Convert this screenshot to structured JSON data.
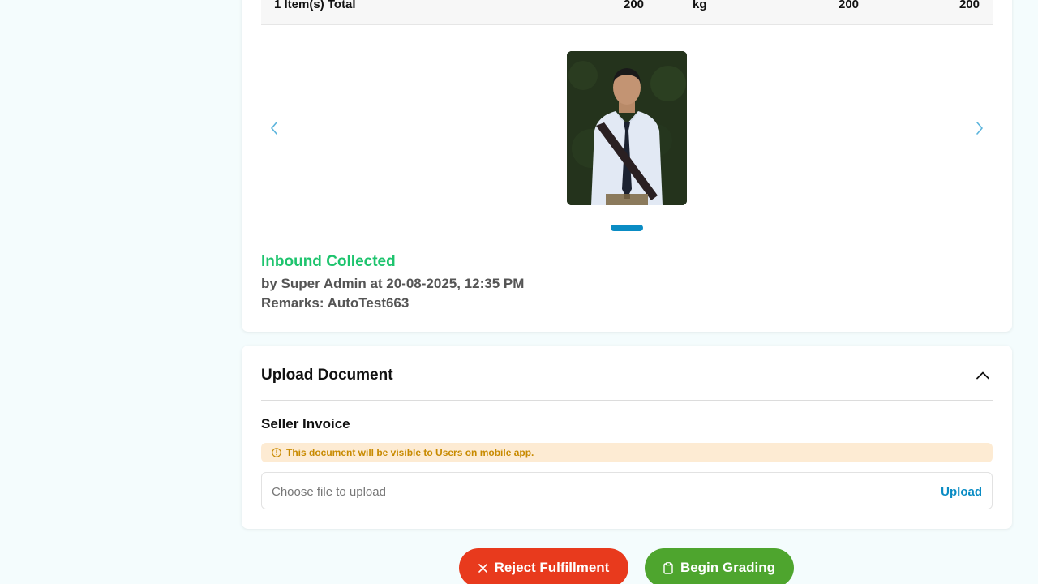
{
  "items_total": {
    "label": "1 Item(s) Total",
    "quantity": "200",
    "unit": "kg",
    "weight": "200",
    "amount": "200"
  },
  "carousel": {
    "prev_icon": "chevron-left-icon",
    "next_icon": "chevron-right-icon",
    "active_index": 0,
    "total_slides": 1,
    "accent_color": "#0a8cc4"
  },
  "inbound_status": {
    "title": "Inbound Collected",
    "by_line": "by Super Admin at 20-08-2025, 12:35 PM",
    "remarks": "Remarks: AutoTest663",
    "title_color": "#1ec46e"
  },
  "upload_document": {
    "title": "Upload Document",
    "collapse_icon": "chevron-up-icon",
    "section_label": "Seller Invoice",
    "notice": "This document will be visible to Users on mobile app.",
    "notice_icon": "info-icon",
    "file_placeholder": "Choose file to upload",
    "upload_label": "Upload"
  },
  "actions": {
    "reject_label": "Reject Fulfillment",
    "reject_icon": "close-icon",
    "reject_color": "#e83a1d",
    "grade_label": "Begin Grading",
    "grade_icon": "clipboard-icon",
    "grade_color": "#4ea52e"
  }
}
